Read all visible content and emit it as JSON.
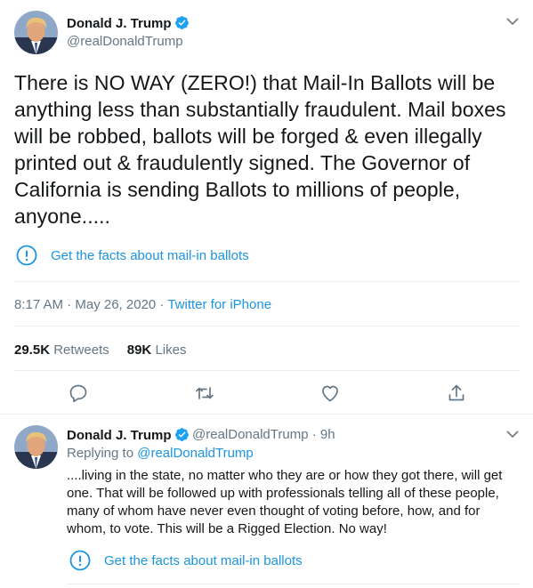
{
  "main_tweet": {
    "author_name": "Donald J. Trump",
    "handle": "@realDonaldTrump",
    "text": "There is NO WAY (ZERO!) that Mail-In Ballots will be anything less than substantially fraudulent. Mail boxes will be robbed, ballots will be forged & even illegally printed out & fraudulently signed. The Governor of California is sending Ballots to millions of people, anyone.....",
    "fact_check_label": "Get the facts about mail-in ballots",
    "time": "8:17 AM · May 26, 2020",
    "separator": " · ",
    "source": "Twitter for iPhone",
    "retweets_count": "29.5K",
    "retweets_label": "Retweets",
    "likes_count": "89K",
    "likes_label": "Likes"
  },
  "reply_tweet": {
    "author_name": "Donald J. Trump",
    "handle_and_time": "@realDonaldTrump · 9h",
    "replying_prefix": "Replying to ",
    "replying_to": "@realDonaldTrump",
    "text": "....living in the state, no matter who they are or how they got there, will get one. That will be followed up with professionals telling all of these people, many of whom have never even thought of voting before, how, and for whom, to vote. This will be a Rigged Election. No way!",
    "fact_check_label": "Get the facts about mail-in ballots"
  },
  "icons": {
    "verified": "verified-badge-icon",
    "caret": "chevron-down-icon",
    "fact_check": "exclamation-circle-icon",
    "reply": "reply-icon",
    "retweet": "retweet-icon",
    "like": "heart-icon",
    "share": "share-icon"
  },
  "colors": {
    "link_blue": "#1b95e0",
    "verified_blue": "#1da1f2",
    "muted_text": "#657786",
    "primary_text": "#14171a",
    "divider": "#e6ecf0"
  }
}
